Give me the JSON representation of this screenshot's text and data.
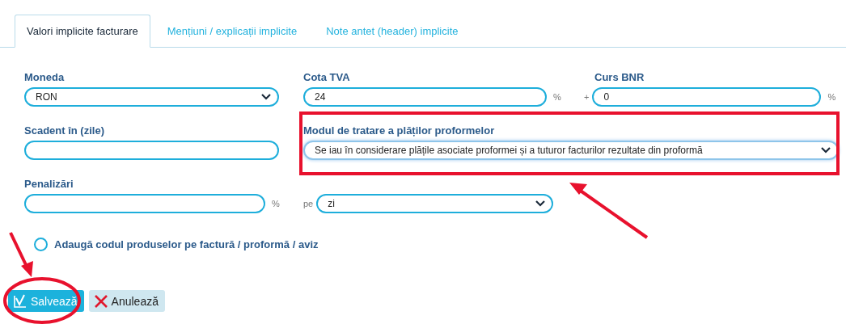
{
  "tabs": [
    {
      "label": "Valori implicite facturare",
      "selected": true
    },
    {
      "label": "Mențiuni / explicații implicite",
      "selected": false
    },
    {
      "label": "Note antet (header) implicite",
      "selected": false
    }
  ],
  "fields": [
    {
      "label": "Moneda",
      "kind": "select",
      "value": "RON"
    },
    {
      "label": "Cota TVA",
      "kind": "input",
      "value": "24",
      "suffix": "%"
    },
    {
      "label": "Curs BNR",
      "kind": "input",
      "value": "0",
      "prefix": "+",
      "suffix": "%"
    },
    {
      "label": "Scadent în (zile)",
      "kind": "input"
    },
    {
      "label": "Modul de tratare a plăților proformelor",
      "kind": "select",
      "value": "Se iau în considerare plățile asociate proformei și a tuturor facturilor rezultate din proformă",
      "wide": true
    },
    {
      "label": "Penalizări",
      "kind": "input",
      "suffix": "%"
    },
    {
      "kind": "select",
      "value": "zi",
      "prefix": "pe"
    }
  ],
  "checkbox": {
    "label": "Adaugă codul produselor pe factură / proformă / aviz",
    "checked": false
  },
  "buttons": [
    {
      "label": "Salvează",
      "kind": "save"
    },
    {
      "label": "Anulează",
      "kind": "cancel"
    }
  ]
}
